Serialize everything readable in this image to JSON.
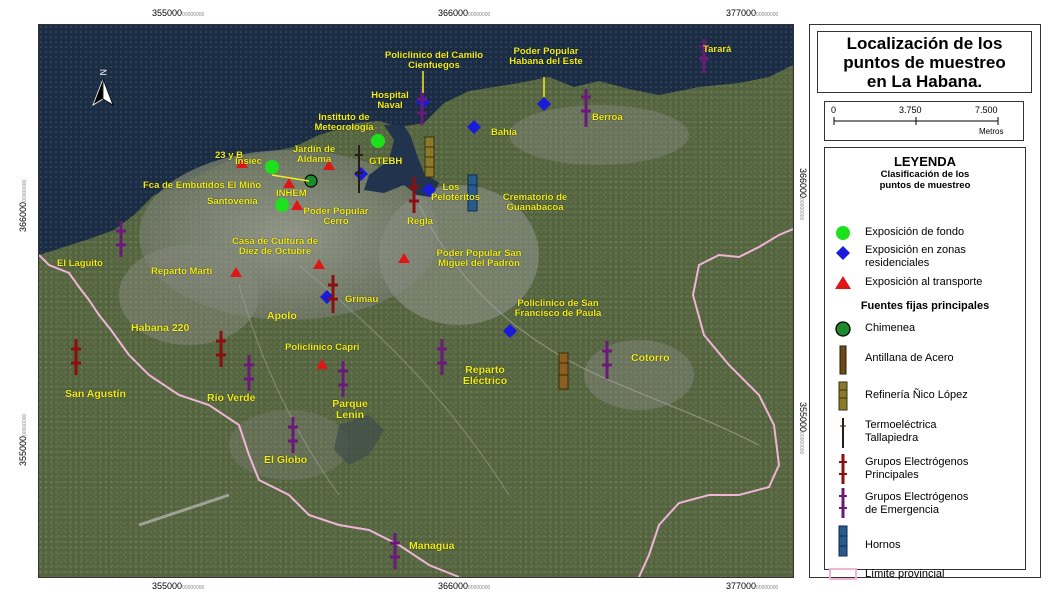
{
  "title": "Localización de los puntos de muestreo en La Habana.",
  "title_lines": [
    "Localización de los",
    "puntos de muestreo",
    "en La Habana."
  ],
  "axis": {
    "top": [
      "355000",
      "366000",
      "377000"
    ],
    "bottom": [
      "355000",
      "366000",
      "377000"
    ],
    "left": [
      "366000",
      "355000"
    ],
    "right": [
      "366000",
      "355000"
    ],
    "unit_tag": "00000000"
  },
  "scale_bar": {
    "ticks": [
      "0",
      "3.750",
      "7.500"
    ],
    "unit": "Metros"
  },
  "legend": {
    "title": "LEYENDA",
    "subtitle_lines": [
      "Clasificación de los",
      "puntos de muestreo"
    ],
    "sampling": [
      {
        "symbol": "green-circle",
        "label": "Exposición de fondo",
        "color": "#1ee11e"
      },
      {
        "symbol": "blue-diamond",
        "label_lines": [
          "Exposición en zonas",
          "residenciales"
        ],
        "color": "#1a1adb"
      },
      {
        "symbol": "red-triangle",
        "label": "Exposición al transporte",
        "color": "#e01515"
      }
    ],
    "sources_title": "Fuentes fijas principales",
    "sources": [
      {
        "symbol": "chimney-icon",
        "label": "Chimenea",
        "color": "#1e8a2e"
      },
      {
        "symbol": "antillana-icon",
        "label": "Antillana de Acero",
        "color": "#6b4a1a"
      },
      {
        "symbol": "refinery-icon",
        "label": "Refinería Ñico López",
        "color": "#8a7a2a"
      },
      {
        "symbol": "thermo-icon",
        "label_lines": [
          "Termoeléctrica",
          "Tallapiedra"
        ],
        "color": "#2a1a1a"
      },
      {
        "symbol": "main-generator-icon",
        "label_lines": [
          "Grupos Electrógenos",
          "Principales"
        ],
        "color": "#8a1010"
      },
      {
        "symbol": "emergency-generator-icon",
        "label_lines": [
          "Grupos Electrógenos",
          "de Emergencia"
        ],
        "color": "#6a1a7a"
      },
      {
        "symbol": "furnace-icon",
        "label": "Hornos",
        "color": "#2a5a8a"
      },
      {
        "symbol": "boundary-line",
        "label": "Límite provincial",
        "color": "#f0b4d6"
      }
    ]
  },
  "place_labels": [
    "Policlinico del Camilo Cienfuegos",
    "Poder Popular Habana del Este",
    "Tarará",
    "Hospital Naval",
    "Berroa",
    "Instituto de Meteorología",
    "Bahía",
    "23 y B",
    "Insiec",
    "Jardín de Aldama",
    "GTEBH",
    "Fca de Embutidos El Miño",
    "INHEM",
    "Los Pelotéritos",
    "Crematorio de Guanabacoa",
    "Santovenia",
    "Poder Popular Cerro",
    "Regla",
    "Casa de Cultura de Diez de Octubre",
    "Poder Popular San Miguel del Padrón",
    "El Laguito",
    "Reparto Martí",
    "Grimau",
    "Policlinico de San Francisco de Paula",
    "Apolo",
    "Habana 220",
    "Policlinico Capri",
    "Reparto Eléctrico",
    "Cotorro",
    "San Agustín",
    "Río Verde",
    "Parque Lenin",
    "El Globo",
    "Managua"
  ],
  "colors": {
    "sea": "#1c2f4a",
    "land": "#5a6b48",
    "urban": "#8c8f85",
    "label": "#f2ee1c",
    "boundary": "#f0b4d6"
  }
}
